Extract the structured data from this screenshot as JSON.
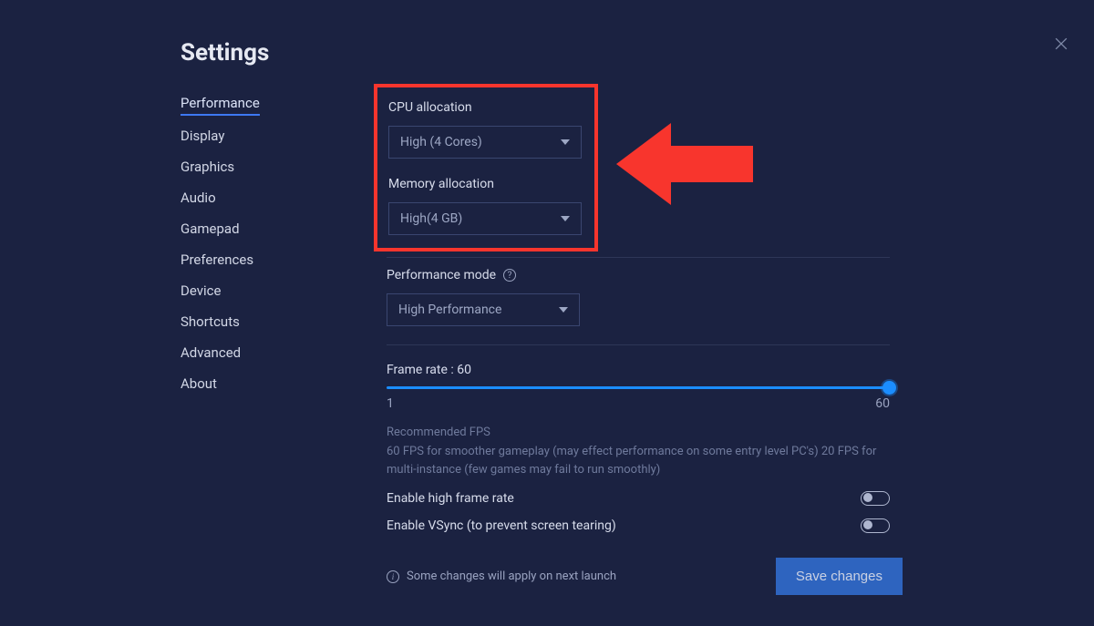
{
  "title": "Settings",
  "sidebar": {
    "items": [
      {
        "label": "Performance",
        "active": true
      },
      {
        "label": "Display"
      },
      {
        "label": "Graphics"
      },
      {
        "label": "Audio"
      },
      {
        "label": "Gamepad"
      },
      {
        "label": "Preferences"
      },
      {
        "label": "Device"
      },
      {
        "label": "Shortcuts"
      },
      {
        "label": "Advanced"
      },
      {
        "label": "About"
      }
    ]
  },
  "cpu": {
    "label": "CPU allocation",
    "value": "High (4 Cores)"
  },
  "memory": {
    "label": "Memory allocation",
    "value": "High(4 GB)"
  },
  "perfmode": {
    "label": "Performance mode",
    "value": "High Performance"
  },
  "frame": {
    "label": "Frame rate : 60",
    "min": "1",
    "max": "60",
    "rec_title": "Recommended FPS",
    "rec_body": "60 FPS for smoother gameplay (may effect performance on some entry level PC's) 20 FPS for multi-instance (few games may fail to run smoothly)"
  },
  "toggles": {
    "high_frame": "Enable high frame rate",
    "vsync": "Enable VSync (to prevent screen tearing)"
  },
  "footer": {
    "note": "Some changes will apply on next launch",
    "save": "Save changes"
  },
  "annotation": {
    "highlight_color": "#f8352d"
  }
}
